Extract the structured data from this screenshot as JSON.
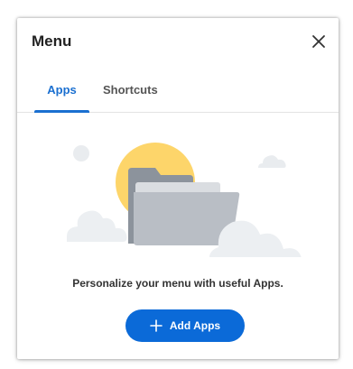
{
  "menu": {
    "title": "Menu",
    "close_icon": "close-icon"
  },
  "tabs": [
    {
      "label": "Apps",
      "selected": true
    },
    {
      "label": "Shortcuts",
      "selected": false
    }
  ],
  "empty_state": {
    "illustration": "folder-with-sun-and-clouds",
    "message": "Personalize your menu with useful Apps.",
    "button_label": "Add Apps",
    "button_icon": "plus-icon"
  },
  "colors": {
    "accent": "#1a6fd0",
    "button_bg": "#0b6ad8",
    "sun": "#fdd56a",
    "folder_back": "#8c939c",
    "folder_front": "#b9bec5",
    "cloud": "#eceff2"
  }
}
